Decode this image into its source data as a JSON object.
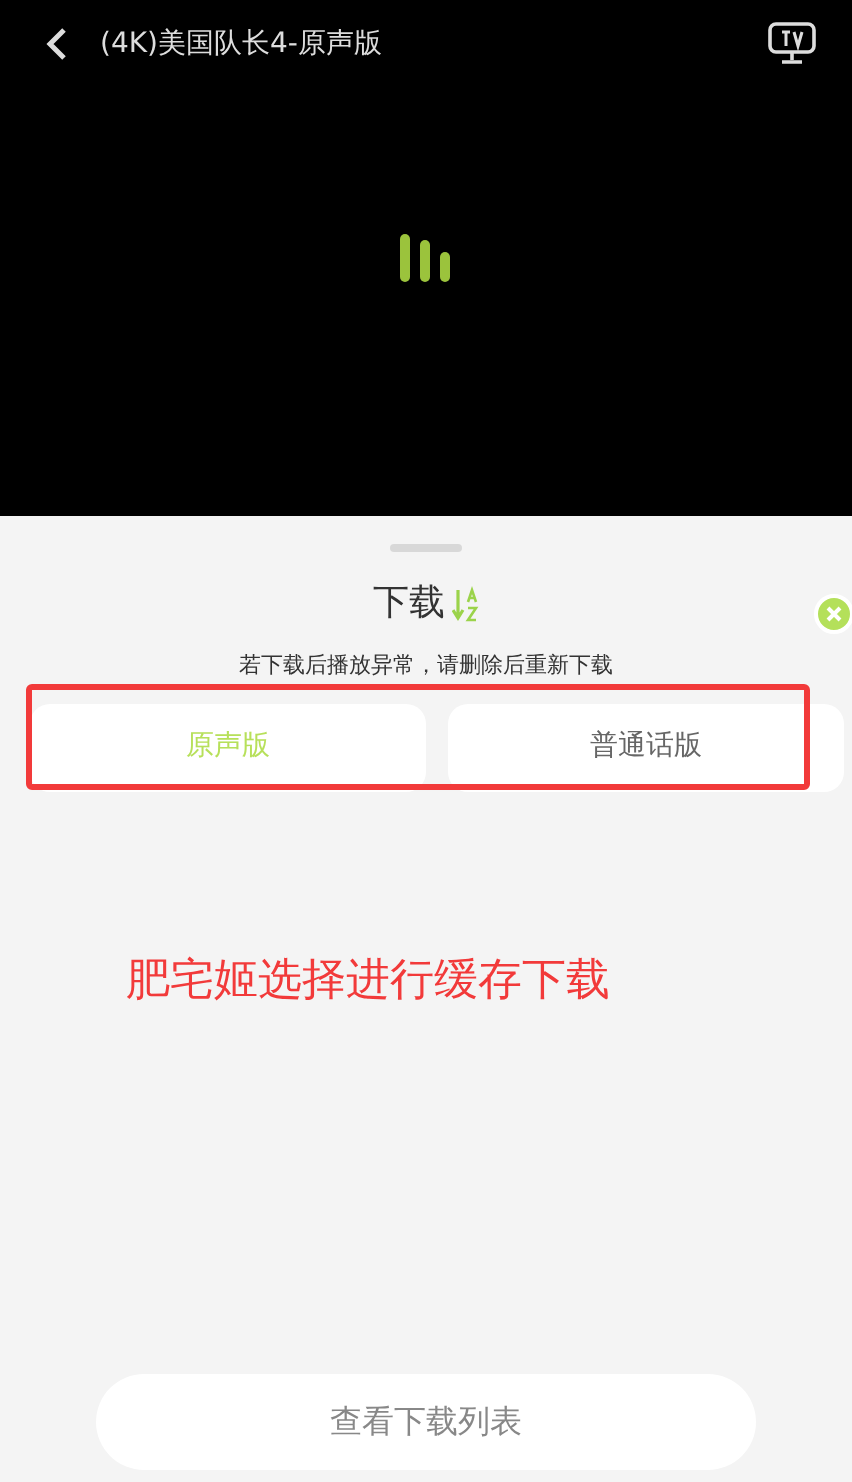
{
  "player": {
    "title": "(4K)美国队长4-原声版"
  },
  "sheet": {
    "title": "下载",
    "notice": "若下载后播放异常，请删除后重新下载",
    "options": [
      {
        "label": "原声版",
        "selected": true
      },
      {
        "label": "普通话版",
        "selected": false
      }
    ],
    "annotation": "肥宅姬选择进行缓存下载",
    "list_button": "查看下载列表"
  }
}
